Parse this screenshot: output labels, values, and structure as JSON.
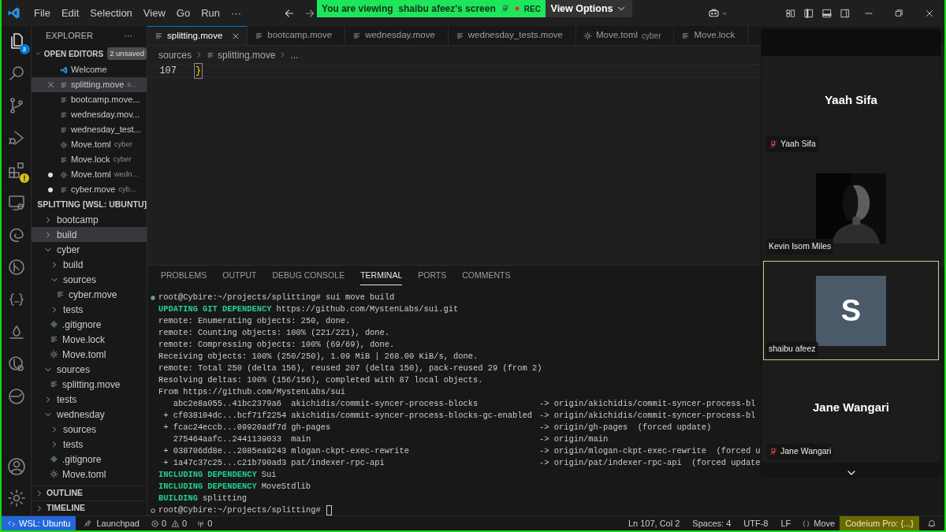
{
  "title_bar": {
    "menu": [
      "File",
      "Edit",
      "Selection",
      "View",
      "Go",
      "Run",
      "···"
    ],
    "share_banner": {
      "text": "You are viewing  shaibu afeez's screen",
      "rec": "REC"
    },
    "view_options": "View Options"
  },
  "activity_bar": {
    "items": [
      {
        "kind": "files",
        "badge": "2",
        "selected": true
      },
      {
        "kind": "search",
        "selected": false
      },
      {
        "kind": "branch",
        "selected": false
      },
      {
        "kind": "debug",
        "selected": false
      },
      {
        "kind": "blocks",
        "warning": true,
        "selected": false
      },
      {
        "kind": "monitor",
        "selected": false
      },
      {
        "kind": "swirl",
        "selected": false
      },
      {
        "kind": "branch-circle",
        "selected": false
      },
      {
        "kind": "braces",
        "selected": false
      },
      {
        "kind": "drop",
        "selected": false
      },
      {
        "kind": "testing",
        "selected": false
      },
      {
        "kind": "whale",
        "selected": false
      }
    ],
    "bottom": [
      {
        "kind": "account"
      },
      {
        "kind": "gear"
      }
    ]
  },
  "sidebar": {
    "title": "EXPLORER",
    "more": "···",
    "open_editors": {
      "title": "OPEN EDITORS",
      "badge": "2 unsaved",
      "items": [
        {
          "name": "Welcome",
          "kind": "vscode",
          "dirty": false,
          "selected": false
        },
        {
          "name": "splitting.move",
          "description": "s...",
          "kind": "move",
          "dirty": false,
          "selected": true
        },
        {
          "name": "bootcamp.move...",
          "kind": "move",
          "dirty": false,
          "selected": false
        },
        {
          "name": "wednesday.mov...",
          "kind": "move",
          "dirty": false,
          "selected": false
        },
        {
          "name": "wednesday_test...",
          "kind": "move",
          "dirty": false,
          "selected": false
        },
        {
          "name": "Move.toml",
          "description": "cyber",
          "kind": "toml",
          "dirty": false,
          "selected": false
        },
        {
          "name": "Move.lock",
          "description": "cyber",
          "kind": "move",
          "dirty": false,
          "selected": false
        },
        {
          "name": "Move.toml",
          "description": "wedn...",
          "kind": "toml",
          "dirty": true,
          "selected": false
        },
        {
          "name": "cyber.move",
          "description": "cyb...",
          "kind": "move",
          "dirty": true,
          "selected": false
        }
      ]
    },
    "workspace": {
      "title": "SPLITTING [WSL: UBUNTU]",
      "items": [
        {
          "name": "bootcamp",
          "kind": "folder",
          "expanded": false,
          "selected": false
        },
        {
          "name": "build",
          "kind": "folder",
          "expanded": false,
          "selected": true
        },
        {
          "name": "cyber",
          "kind": "folder",
          "expanded": true,
          "selected": false,
          "children": [
            {
              "name": "build",
              "kind": "folder",
              "expanded": false,
              "selected": false
            },
            {
              "name": "sources",
              "kind": "folder",
              "expanded": true,
              "selected": false,
              "children": [
                {
                  "name": "cyber.move",
                  "kind": "move",
                  "selected": false
                }
              ]
            },
            {
              "name": "tests",
              "kind": "folder",
              "expanded": false,
              "selected": false
            },
            {
              "name": ".gitignore",
              "kind": "git",
              "selected": false
            },
            {
              "name": "Move.lock",
              "kind": "move",
              "selected": false
            },
            {
              "name": "Move.toml",
              "kind": "toml",
              "selected": false
            }
          ]
        },
        {
          "name": "sources",
          "kind": "folder",
          "expanded": true,
          "selected": false,
          "children": [
            {
              "name": "splitting.move",
              "kind": "move",
              "selected": false
            }
          ]
        },
        {
          "name": "tests",
          "kind": "folder",
          "expanded": false,
          "selected": false
        },
        {
          "name": "wednesday",
          "kind": "folder",
          "expanded": true,
          "selected": false,
          "children": [
            {
              "name": "sources",
              "kind": "folder",
              "expanded": false,
              "selected": false
            },
            {
              "name": "tests",
              "kind": "folder",
              "expanded": false,
              "selected": false
            },
            {
              "name": ".gitignore",
              "kind": "git",
              "selected": false
            },
            {
              "name": "Move.toml",
              "kind": "toml",
              "selected": false
            }
          ]
        }
      ]
    },
    "sections": [
      {
        "title": "OUTLINE",
        "expanded": false
      },
      {
        "title": "TIMELINE",
        "expanded": false
      }
    ]
  },
  "editor": {
    "tabs": [
      {
        "label": "splitting.move",
        "kind": "move",
        "selected": true
      },
      {
        "label": "bootcamp.move",
        "kind": "move",
        "selected": false
      },
      {
        "label": "wednesday.move",
        "kind": "move",
        "selected": false
      },
      {
        "label": "wednesday_tests.move",
        "kind": "move",
        "selected": false
      },
      {
        "label": "Move.toml",
        "description": "cyber",
        "kind": "toml",
        "selected": false
      },
      {
        "label": "Move.lock",
        "kind": "move",
        "selected": false
      }
    ],
    "breadcrumb": [
      "sources",
      "splitting.move",
      "..."
    ],
    "lines": [
      {
        "number": "107",
        "text": "}"
      }
    ]
  },
  "panel": {
    "tabs": [
      {
        "label": "PROBLEMS",
        "selected": false
      },
      {
        "label": "OUTPUT",
        "selected": false
      },
      {
        "label": "DEBUG CONSOLE",
        "selected": false
      },
      {
        "label": "TERMINAL",
        "selected": true
      },
      {
        "label": "PORTS",
        "selected": false
      },
      {
        "label": "COMMENTS",
        "selected": false
      }
    ],
    "terminal": [
      {
        "kind": "prompt",
        "succeeded": true,
        "text": "root@Cybire:~/projects/splitting# sui move build"
      },
      {
        "kind": "output",
        "label": "UPDATING GIT DEPENDENCY",
        "text": "https://github.com/MystenLabs/sui.git"
      },
      {
        "kind": "output",
        "text": "remote: Enumerating objects: 250, done."
      },
      {
        "kind": "output",
        "text": "remote: Counting objects: 100% (221/221), done."
      },
      {
        "kind": "output",
        "text": "remote: Compressing objects: 100% (69/69), done."
      },
      {
        "kind": "output",
        "text": "Receiving objects: 100% (250/250), 1.09 MiB | 268.00 KiB/s, done."
      },
      {
        "kind": "output",
        "text": "remote: Total 250 (delta 156), reused 207 (delta 150), pack-reused 29 (from 2)"
      },
      {
        "kind": "output",
        "text": "Resolving deltas: 100% (156/156), completed with 87 local objects."
      },
      {
        "kind": "output",
        "text": "From https://github.com/MystenLabs/sui"
      },
      {
        "kind": "ref",
        "ref": "   abc2e8a055..41bc2379a6  akichidis/commit-syncer-process-blocks",
        "target": "-> origin/akichidis/commit-syncer-process-bl"
      },
      {
        "kind": "ref",
        "ref": " + cf038104dc...bcf71f2254 akichidis/commit-syncer-process-blocks-gc-enabled",
        "target": "-> origin/akichidis/commit-syncer-process-bl"
      },
      {
        "kind": "ref",
        "ref": " + fcac24eccb...09920adf7d gh-pages",
        "target": "-> origin/gh-pages  (forced update)"
      },
      {
        "kind": "ref",
        "ref": "   275464aafc..2441139033  main",
        "target": "-> origin/main"
      },
      {
        "kind": "ref",
        "ref": " + 038706dd8e...2085ea9243 mlogan-ckpt-exec-rewrite",
        "target": "-> origin/mlogan-ckpt-exec-rewrite  (forced u"
      },
      {
        "kind": "ref",
        "ref": " + 1a47c37c25...c21b790ad3 pat/indexer-rpc-api",
        "target": "-> origin/pat/indexer-rpc-api  (forced update"
      },
      {
        "kind": "output",
        "label": "INCLUDING DEPENDENCY",
        "text": "Sui"
      },
      {
        "kind": "output",
        "label": "INCLUDING DEPENDENCY",
        "text": "MoveStdlib"
      },
      {
        "kind": "output",
        "label": "BUILDING",
        "text": "splitting"
      },
      {
        "kind": "prompt",
        "succeeded": false,
        "text": "root@Cybire:~/projects/splitting#",
        "cursor": true
      }
    ]
  },
  "meeting": {
    "participants": [
      {
        "kind": "name",
        "display_name": "Yaah Sifa",
        "name": "Yaah Sifa",
        "muted": true,
        "selected": false
      },
      {
        "kind": "picture",
        "name": "Kevin Isom Miles",
        "muted": false,
        "selected": false
      },
      {
        "kind": "avatar",
        "initial": "S",
        "name": "shaibu afeez",
        "muted": false,
        "selected": true
      },
      {
        "kind": "name",
        "display_name": "Jane Wangari",
        "name": "Jane Wangari",
        "muted": true,
        "selected": false
      }
    ]
  },
  "status_bar": {
    "left": [
      {
        "kind": "remote",
        "text": "WSL: Ubuntu"
      },
      {
        "kind": "launchpad",
        "text": "Launchpad"
      },
      {
        "kind": "problems",
        "errors": "0",
        "warnings": "0"
      },
      {
        "kind": "ports",
        "text": "0"
      }
    ],
    "right": [
      {
        "kind": "text",
        "text": "Ln 107, Col 2"
      },
      {
        "kind": "text",
        "text": "Spaces: 4"
      },
      {
        "kind": "text",
        "text": "UTF-8"
      },
      {
        "kind": "text",
        "text": "LF"
      },
      {
        "kind": "language",
        "text": "Move"
      },
      {
        "kind": "highlight",
        "text": "Codeium Pro: {...}"
      },
      {
        "kind": "bell"
      }
    ]
  }
}
